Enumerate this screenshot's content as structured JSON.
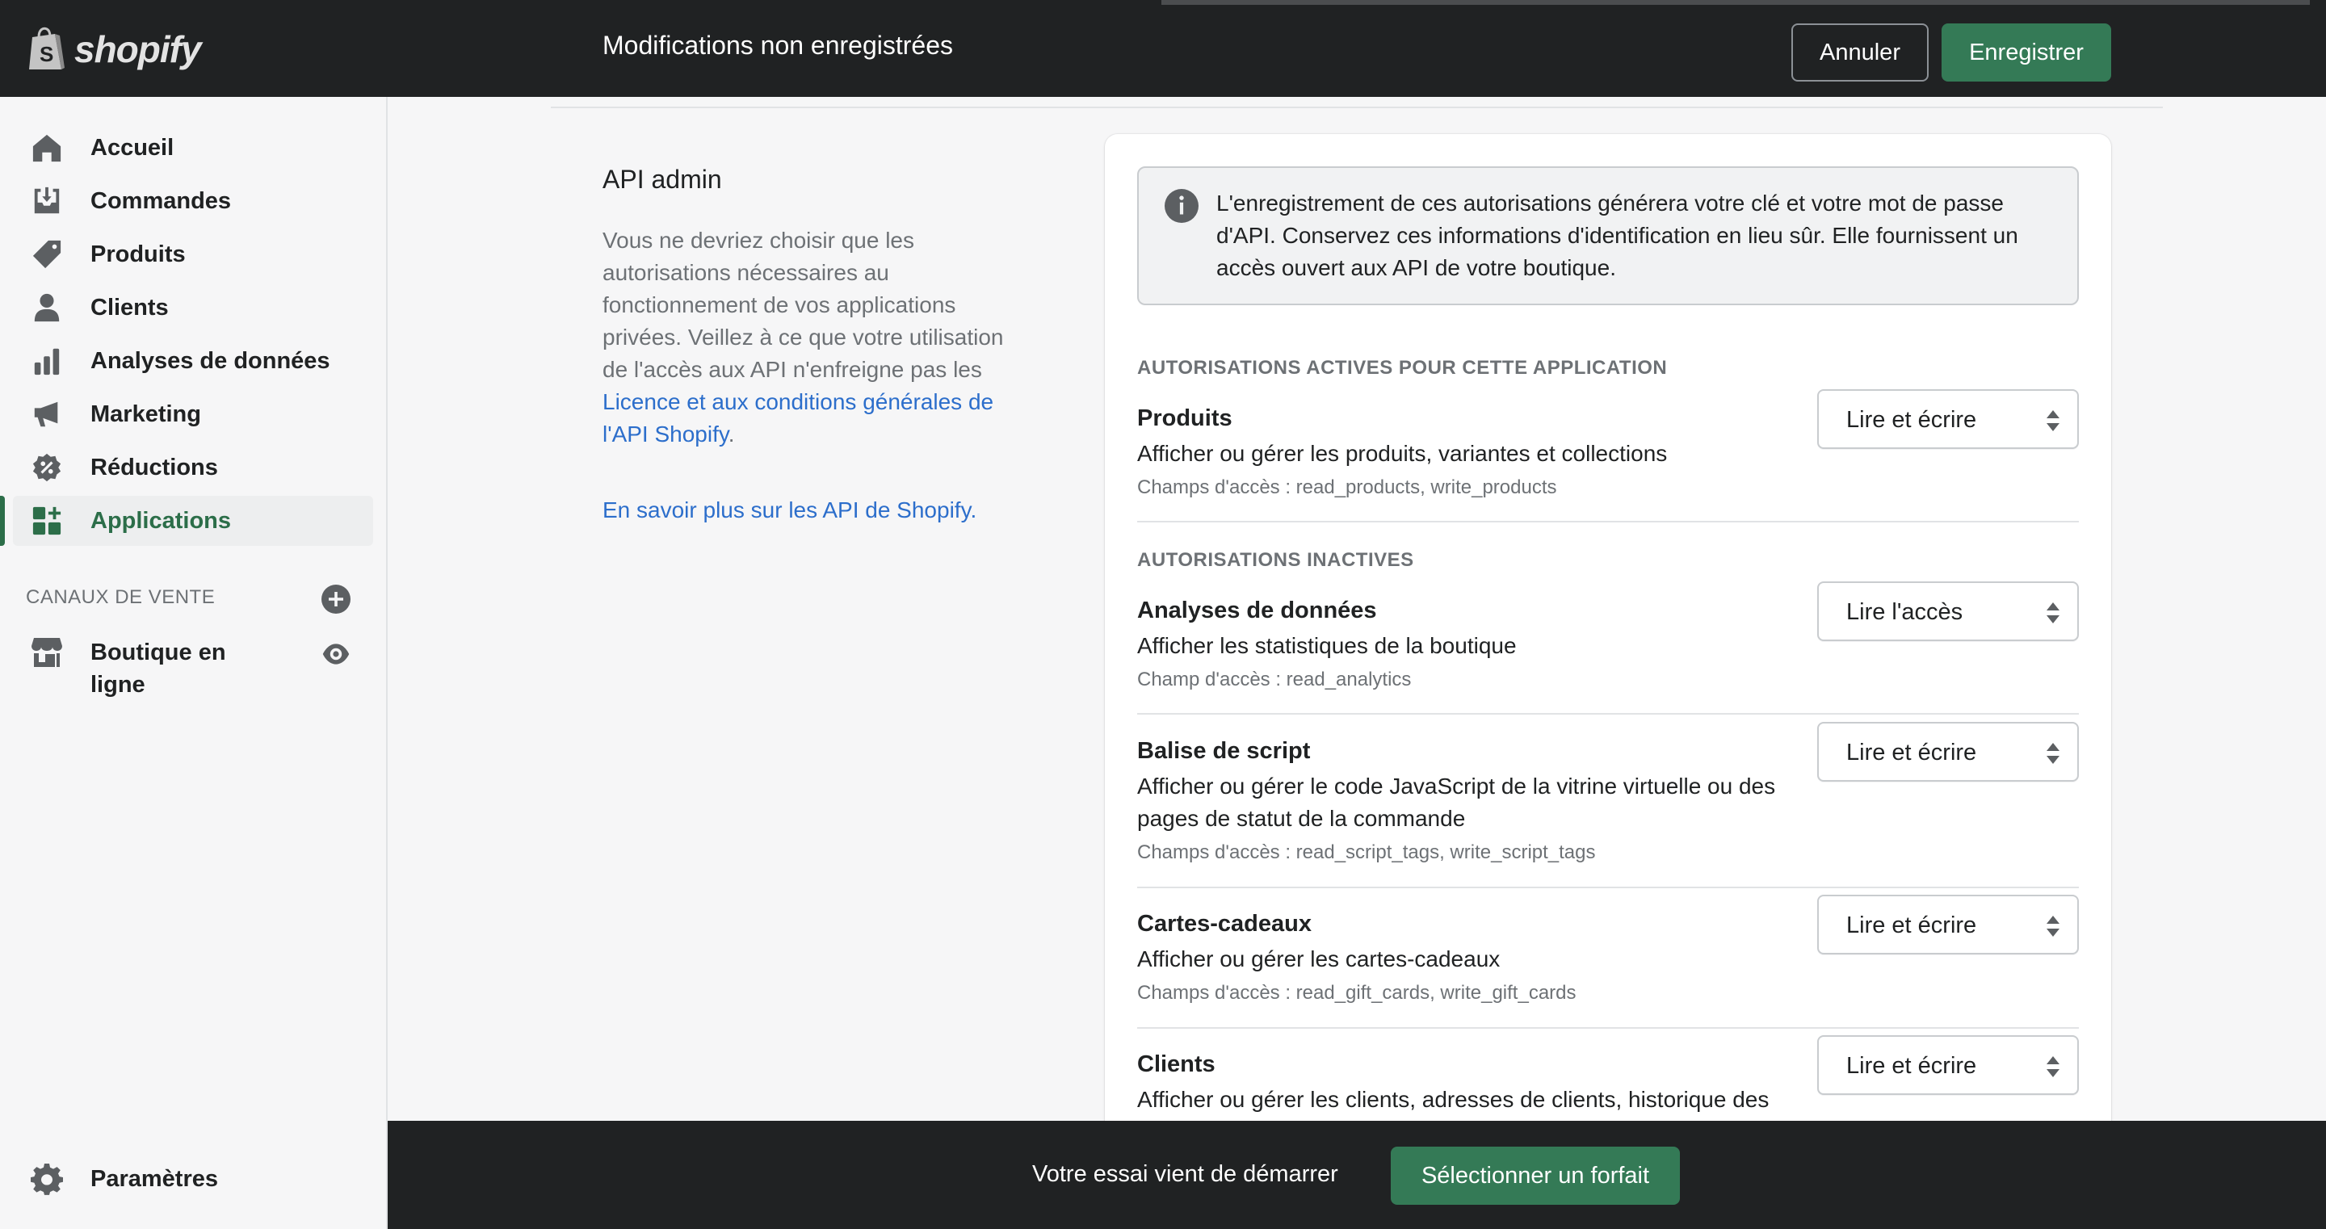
{
  "brand": {
    "name": "shopify",
    "accent": "#2c6e49"
  },
  "topbar": {
    "title": "Modifications non enregistrées",
    "cancel_label": "Annuler",
    "save_label": "Enregistrer"
  },
  "sidebar": {
    "items": [
      {
        "label": "Accueil",
        "icon": "home-icon"
      },
      {
        "label": "Commandes",
        "icon": "orders-icon"
      },
      {
        "label": "Produits",
        "icon": "tag-icon"
      },
      {
        "label": "Clients",
        "icon": "person-icon"
      },
      {
        "label": "Analyses de données",
        "icon": "bar-chart-icon"
      },
      {
        "label": "Marketing",
        "icon": "megaphone-icon"
      },
      {
        "label": "Réductions",
        "icon": "discount-icon"
      },
      {
        "label": "Applications",
        "icon": "apps-icon",
        "active": true
      }
    ],
    "sales_channels_label": "CANAUX DE VENTE",
    "channel": {
      "label": "Boutique en ligne",
      "icon": "store-icon"
    },
    "settings_label": "Paramètres"
  },
  "main": {
    "section_title": "API admin",
    "description_prefix": "Vous ne devriez choisir que les autorisations nécessaires au fonctionnement de vos applications privées. Veillez à ce que votre utilisation de l'accès aux API n'enfreigne pas les ",
    "description_link": "Licence et aux conditions générales de l'API Shopify",
    "description_suffix": ".",
    "learn_more": "En savoir plus sur les API de Shopify."
  },
  "card": {
    "banner_text": "L'enregistrement de ces autorisations générera votre clé et votre mot de passe d'API. Conservez ces informations d'identification en lieu sûr. Elle fournissent un accès ouvert aux API de votre boutique.",
    "active_title": "AUTORISATIONS ACTIVES POUR CETTE APPLICATION",
    "inactive_title": "AUTORISATIONS INACTIVES",
    "permissions": [
      {
        "name": "Produits",
        "description": "Afficher ou gérer les produits, variantes et collections",
        "scope": "Champs d'accès : read_products, write_products",
        "value": "Lire et écrire"
      },
      {
        "name": "Analyses de données",
        "description": "Afficher les statistiques de la boutique",
        "scope": "Champ d'accès : read_analytics",
        "value": "Lire l'accès"
      },
      {
        "name": "Balise de script",
        "description": "Afficher ou gérer le code JavaScript de la vitrine virtuelle ou des pages de statut de la commande",
        "scope": "Champs d'accès : read_script_tags, write_script_tags",
        "value": "Lire et écrire"
      },
      {
        "name": "Cartes-cadeaux",
        "description": "Afficher ou gérer les cartes-cadeaux",
        "scope": "Champs d'accès : read_gift_cards, write_gift_cards",
        "value": "Lire et écrire"
      },
      {
        "name": "Clients",
        "description": "Afficher ou gérer les clients, adresses de clients, historique des",
        "scope": "",
        "value": "Lire et écrire"
      }
    ]
  },
  "bottombar": {
    "trial_text": "Votre essai vient de démarrer",
    "plan_button": "Sélectionner un forfait"
  }
}
